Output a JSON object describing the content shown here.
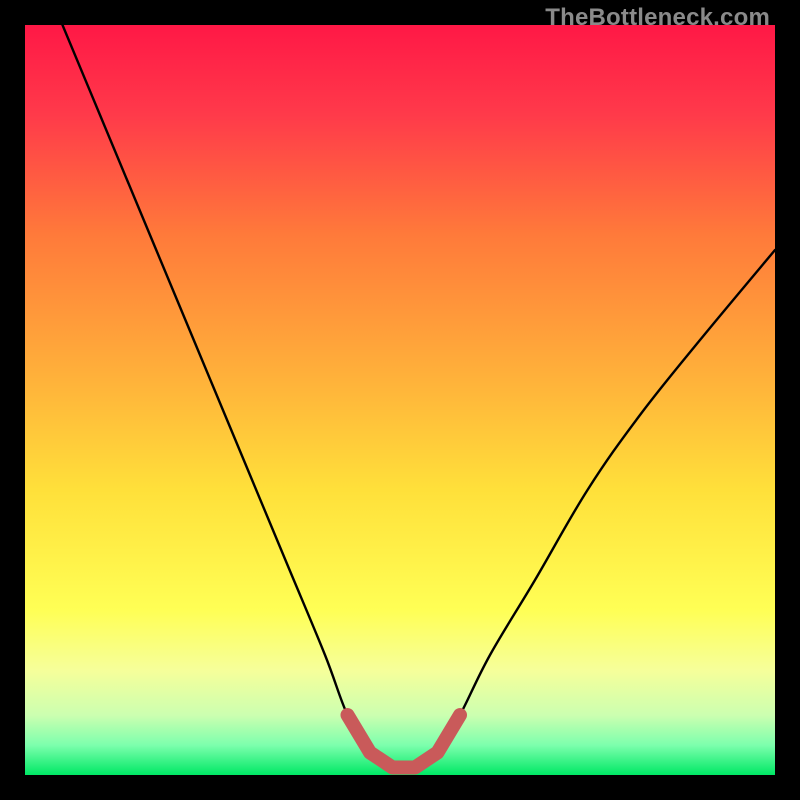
{
  "watermark": "TheBottleneck.com",
  "colors": {
    "frame": "#000000",
    "gradient_top": "#ff1a4a",
    "gradient_mid_upper": "#ff7a3a",
    "gradient_mid": "#ffd93a",
    "gradient_mid_lower": "#ffff66",
    "gradient_lower": "#e8ffb0",
    "gradient_bottom": "#00ff66",
    "curve": "#000000",
    "marker": "#c95a5a"
  },
  "chart_data": {
    "type": "line",
    "title": "",
    "xlabel": "",
    "ylabel": "",
    "xlim": [
      0,
      100
    ],
    "ylim": [
      0,
      100
    ],
    "series": [
      {
        "name": "bottleneck-curve",
        "x": [
          5,
          10,
          15,
          20,
          25,
          30,
          35,
          40,
          43,
          46,
          49,
          52,
          55,
          58,
          62,
          68,
          75,
          82,
          90,
          100
        ],
        "y": [
          100,
          88,
          76,
          64,
          52,
          40,
          28,
          16,
          8,
          3,
          1,
          1,
          3,
          8,
          16,
          26,
          38,
          48,
          58,
          70
        ]
      },
      {
        "name": "optimal-range",
        "x": [
          43,
          46,
          49,
          52,
          55,
          58
        ],
        "y": [
          8,
          3,
          1,
          1,
          3,
          8
        ]
      }
    ],
    "annotations": []
  }
}
